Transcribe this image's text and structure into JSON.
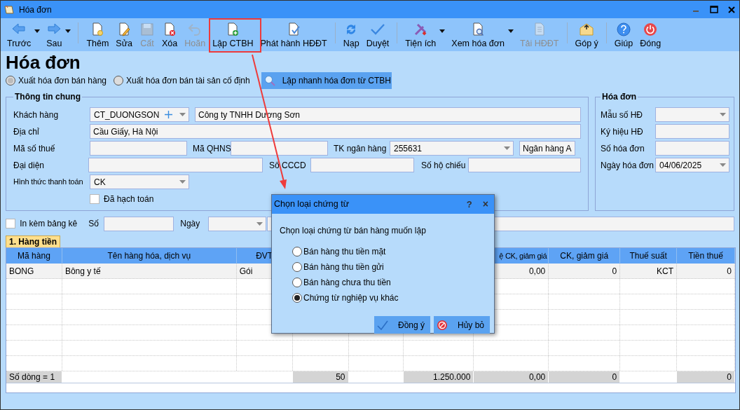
{
  "window": {
    "title": "Hóa đơn"
  },
  "toolbar": [
    {
      "label": "Trước",
      "disabled": false,
      "dropdown": true,
      "separator_after": false
    },
    {
      "label": "Sau",
      "disabled": false,
      "dropdown": true,
      "separator_after": true
    },
    {
      "label": "Thêm",
      "disabled": false,
      "dropdown": false,
      "separator_after": false
    },
    {
      "label": "Sửa",
      "disabled": false,
      "dropdown": false,
      "separator_after": false
    },
    {
      "label": "Cất",
      "disabled": true,
      "dropdown": false,
      "separator_after": false
    },
    {
      "label": "Xóa",
      "disabled": false,
      "dropdown": false,
      "separator_after": false
    },
    {
      "label": "Hoãn",
      "disabled": true,
      "dropdown": false,
      "separator_after": false
    },
    {
      "label": "Lập CTBH",
      "disabled": false,
      "dropdown": false,
      "separator_after": false
    },
    {
      "label": "Phát hành HĐĐT",
      "disabled": false,
      "dropdown": false,
      "separator_after": true
    },
    {
      "label": "Nạp",
      "disabled": false,
      "dropdown": false,
      "separator_after": false
    },
    {
      "label": "Duyệt",
      "disabled": false,
      "dropdown": false,
      "separator_after": true
    },
    {
      "label": "Tiện ích",
      "disabled": false,
      "dropdown": true,
      "separator_after": false
    },
    {
      "label": "Xem hóa đơn",
      "disabled": false,
      "dropdown": true,
      "separator_after": false
    },
    {
      "label": "Tải HĐĐT",
      "disabled": true,
      "dropdown": false,
      "separator_after": true
    },
    {
      "label": "Góp ý",
      "disabled": false,
      "dropdown": false,
      "separator_after": true
    },
    {
      "label": "Giúp",
      "disabled": false,
      "dropdown": false,
      "separator_after": false
    },
    {
      "label": "Đóng",
      "disabled": false,
      "dropdown": false,
      "separator_after": false
    }
  ],
  "heading": "Hóa đơn",
  "invoice_types": [
    {
      "label": "Xuất hóa đơn bán hàng",
      "selected": true
    },
    {
      "label": "Xuất hóa đơn bán tài sản cố định",
      "selected": false
    }
  ],
  "quick_button": "Lập nhanh hóa đơn từ CTBH",
  "general_info": {
    "title": "Thông tin chung",
    "customer": {
      "label": "Khách hàng",
      "code": "CT_DUONGSON",
      "name": "Công ty TNHH Dương Sơn"
    },
    "address": {
      "label": "Địa chỉ",
      "value": "Cầu Giấy, Hà Nội"
    },
    "tax_code": {
      "label": "Mã số thuế"
    },
    "budget_code": {
      "label": "Mã QHNS"
    },
    "bank_account": {
      "label": "TK ngân hàng",
      "value": "255631",
      "bank": "Ngân hàng A"
    },
    "representative": {
      "label": "Đại diện"
    },
    "id_card": {
      "label": "Số CCCD"
    },
    "passport": {
      "label": "Số hộ chiếu"
    },
    "payment_method": {
      "label": "Hình thức thanh toán",
      "value": "CK"
    },
    "posted": {
      "label": "Đã hạch toán",
      "checked": false
    }
  },
  "invoice_info": {
    "title": "Hóa đơn",
    "fields": [
      {
        "label": "Mẫu số HĐ",
        "kind": "combo"
      },
      {
        "label": "Ký hiệu HĐ",
        "kind": "text"
      },
      {
        "label": "Số hóa đơn",
        "kind": "text"
      },
      {
        "label": "Ngày hóa đơn",
        "kind": "combo",
        "value": "04/06/2025"
      }
    ]
  },
  "attachment": {
    "label": "In kèm bảng kê",
    "checked": false,
    "number_label": "Số",
    "date_label": "Ngày"
  },
  "tab": {
    "label": "1. Hàng tiền",
    "selected": true
  },
  "table": {
    "columns": [
      {
        "header": "Mã hàng"
      },
      {
        "header": "Tên hàng hóa, dịch vụ"
      },
      {
        "header": "ĐVT"
      },
      {},
      {},
      {},
      {
        "header": "ệ CK, giảm giá"
      },
      {
        "header": "CK, giảm giá"
      },
      {
        "header": "Thuế suất"
      },
      {
        "header": "Tiền thuế"
      }
    ],
    "rows": [
      [
        {
          "text": "BONG"
        },
        {
          "text": "Bông y tế"
        },
        {
          "text": "Gói"
        },
        {},
        {},
        {},
        {
          "text": "0,00"
        },
        {
          "text": "0"
        },
        {
          "text": "KCT"
        },
        {
          "text": "0"
        }
      ]
    ],
    "footer": {
      "row_count": "Số dòng = 1",
      "column_4": "50",
      "column_6": "1.250.000",
      "column_7": "0,00",
      "column_8": "0",
      "column_10": "0"
    }
  },
  "dialog": {
    "title": "Chọn loại chứng từ",
    "help": "?",
    "close": "×",
    "prompt": "Chọn loại chứng từ bán hàng muốn lập",
    "options": [
      {
        "label": "Bán hàng thu tiền mặt",
        "selected": false
      },
      {
        "label": "Bán hàng thu tiền gửi",
        "selected": false
      },
      {
        "label": "Bán hàng chưa thu tiền",
        "selected": false
      },
      {
        "label": "Chứng từ nghiệp vụ khác",
        "selected": true
      }
    ],
    "ok": "Đồng ý",
    "cancel": "Hủy bỏ"
  }
}
